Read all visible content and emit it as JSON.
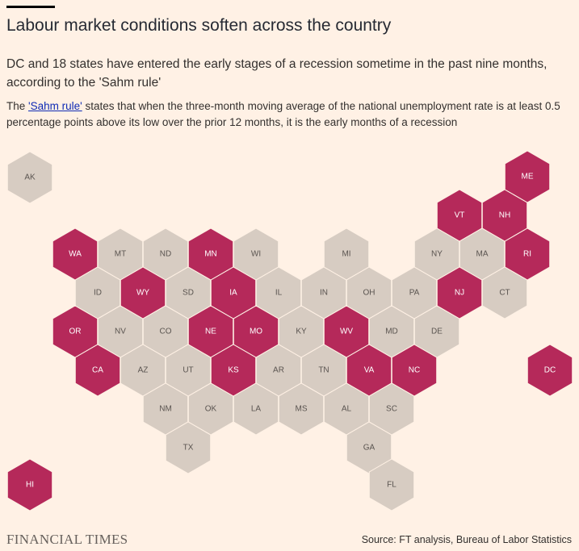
{
  "title": "Labour market conditions soften across the country",
  "subtitle": "DC and 18 states have entered the early stages of a recession sometime in the past nine months, according to the 'Sahm rule'",
  "note": {
    "link_text": "'Sahm rule'",
    "prefix": "The ",
    "suffix": " states that when the three-month moving average of the national unemployment rate is at least 0.5 percentage points above its low over the prior 12 months, it is the early months of a recession"
  },
  "colors": {
    "recession": "#B5295A",
    "no_recession": "#D7CCC2",
    "label_on_recession": "#FFFFFF",
    "label_on_no_recession": "#5A5450"
  },
  "states": [
    {
      "code": "AK",
      "recession": false
    },
    {
      "code": "ME",
      "recession": true
    },
    {
      "code": "VT",
      "recession": true
    },
    {
      "code": "NH",
      "recession": true
    },
    {
      "code": "WA",
      "recession": true
    },
    {
      "code": "MT",
      "recession": false
    },
    {
      "code": "ND",
      "recession": false
    },
    {
      "code": "MN",
      "recession": true
    },
    {
      "code": "WI",
      "recession": false
    },
    {
      "code": "MI",
      "recession": false
    },
    {
      "code": "NY",
      "recession": false
    },
    {
      "code": "MA",
      "recession": false
    },
    {
      "code": "RI",
      "recession": true
    },
    {
      "code": "ID",
      "recession": false
    },
    {
      "code": "WY",
      "recession": true
    },
    {
      "code": "SD",
      "recession": false
    },
    {
      "code": "IA",
      "recession": true
    },
    {
      "code": "IL",
      "recession": false
    },
    {
      "code": "IN",
      "recession": false
    },
    {
      "code": "OH",
      "recession": false
    },
    {
      "code": "PA",
      "recession": false
    },
    {
      "code": "NJ",
      "recession": true
    },
    {
      "code": "CT",
      "recession": false
    },
    {
      "code": "OR",
      "recession": true
    },
    {
      "code": "NV",
      "recession": false
    },
    {
      "code": "CO",
      "recession": false
    },
    {
      "code": "NE",
      "recession": true
    },
    {
      "code": "MO",
      "recession": true
    },
    {
      "code": "KY",
      "recession": false
    },
    {
      "code": "WV",
      "recession": true
    },
    {
      "code": "MD",
      "recession": false
    },
    {
      "code": "DE",
      "recession": false
    },
    {
      "code": "CA",
      "recession": true
    },
    {
      "code": "AZ",
      "recession": false
    },
    {
      "code": "UT",
      "recession": false
    },
    {
      "code": "KS",
      "recession": true
    },
    {
      "code": "AR",
      "recession": false
    },
    {
      "code": "TN",
      "recession": false
    },
    {
      "code": "VA",
      "recession": true
    },
    {
      "code": "NC",
      "recession": true
    },
    {
      "code": "DC",
      "recession": true
    },
    {
      "code": "NM",
      "recession": false
    },
    {
      "code": "OK",
      "recession": false
    },
    {
      "code": "LA",
      "recession": false
    },
    {
      "code": "MS",
      "recession": false
    },
    {
      "code": "AL",
      "recession": false
    },
    {
      "code": "SC",
      "recession": false
    },
    {
      "code": "TX",
      "recession": false
    },
    {
      "code": "GA",
      "recession": false
    },
    {
      "code": "HI",
      "recession": true
    },
    {
      "code": "FL",
      "recession": false
    }
  ],
  "brand": "FINANCIAL TIMES",
  "source": "Source: FT analysis, Bureau of Labor Statistics"
}
